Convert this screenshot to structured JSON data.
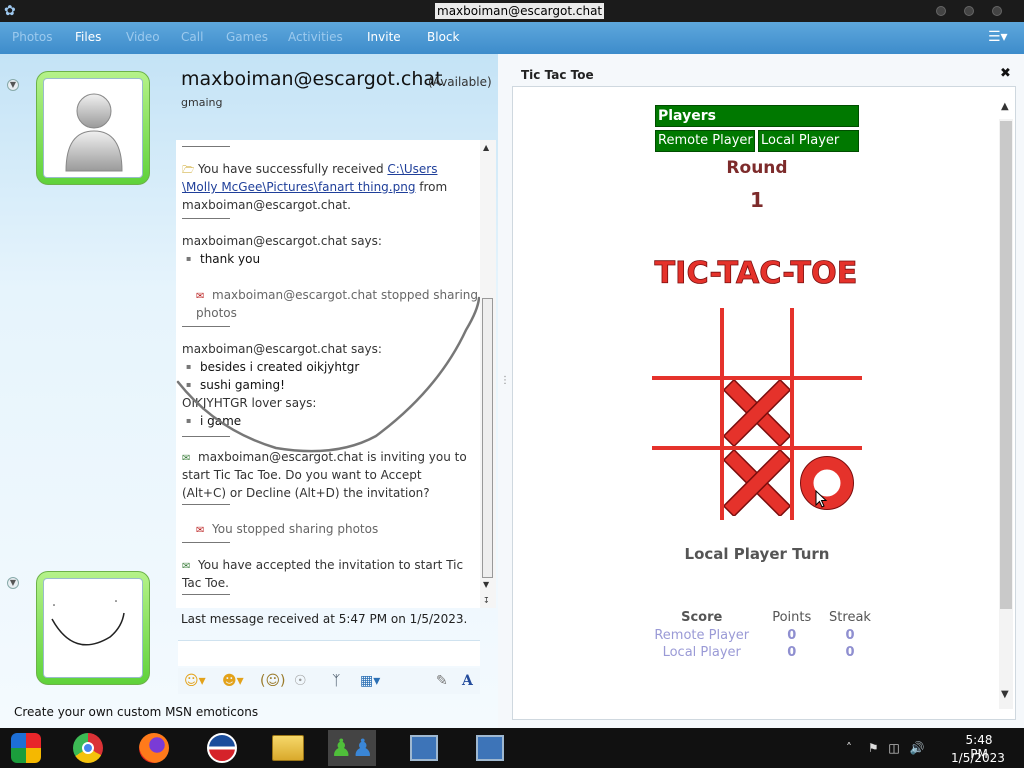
{
  "window": {
    "title": "maxboiman@escargot.chat"
  },
  "menubar": {
    "items": [
      {
        "label": "Photos",
        "enabled": false
      },
      {
        "label": "Files",
        "enabled": true
      },
      {
        "label": "Video",
        "enabled": false
      },
      {
        "label": "Call",
        "enabled": false
      },
      {
        "label": "Games",
        "enabled": false
      },
      {
        "label": "Activities",
        "enabled": false
      },
      {
        "label": "Invite",
        "enabled": true
      },
      {
        "label": "Block",
        "enabled": true
      }
    ]
  },
  "contact": {
    "name": "maxboiman@escargot.chat",
    "status": "(Available)",
    "personal_message": "gmaing"
  },
  "history": {
    "file_received": {
      "prefix": "You have successfully received ",
      "path_line1": "C:\\Users",
      "path_line2": "\\Molly McGee\\Pictures\\fanart thing.png",
      "suffix": " from",
      "from": "maxboiman@escargot.chat."
    },
    "says1": {
      "sender": "maxboiman@escargot.chat says:",
      "messages": [
        "thank you"
      ]
    },
    "stopped_sharing": {
      "line1": "maxboiman@escargot.chat stopped sharing",
      "line2": "photos"
    },
    "says2": {
      "sender": "maxboiman@escargot.chat says:",
      "messages": [
        "besides i created oikjyhtgr",
        "sushi gaming!"
      ]
    },
    "says3": {
      "sender": "OIKJYHTGR lover says:",
      "messages": [
        "i game"
      ]
    },
    "invite": {
      "line1": "maxboiman@escargot.chat is inviting you to",
      "line2": "start Tic Tac Toe. Do you want to Accept",
      "line3": "(Alt+C) or Decline (Alt+D) the invitation?"
    },
    "you_stopped": "You stopped sharing photos",
    "accepted": {
      "line1": "You have accepted the invitation to start Tic",
      "line2": "Tac Toe."
    }
  },
  "last_message": "Last message received at 5:47 PM on 1/5/2023.",
  "create_emoticons": "Create your own custom MSN emoticons",
  "game": {
    "title": "Tic Tac Toe",
    "players_header": "Players",
    "remote_player": "Remote Player",
    "local_player": "Local Player",
    "round_label": "Round",
    "round_number": "1",
    "logo_text": "TIC-TAC-TOE",
    "board": [
      "",
      "",
      "",
      "",
      "X",
      "",
      "",
      "X",
      "O"
    ],
    "turn": "Local Player Turn",
    "score": {
      "headers": [
        "Score",
        "Points",
        "Streak"
      ],
      "rows": [
        {
          "player": "Remote Player",
          "points": "0",
          "streak": "0"
        },
        {
          "player": "Local Player",
          "points": "0",
          "streak": "0"
        }
      ]
    }
  },
  "taskbar": {
    "apps": [
      "msn-icon",
      "chrome-icon",
      "firefox-icon",
      "obama-logo-icon",
      "file-explorer-icon",
      "msn-messenger-icon",
      "network-computer-icon",
      "network-computer-icon"
    ],
    "time": "5:48 PM",
    "date": "1/5/2023"
  },
  "colors": {
    "menubar": "#4a98d3",
    "game_green": "#007800",
    "game_red": "#e5322b",
    "round_text": "#7d2b2b",
    "avatar_green": "#5fd23a"
  }
}
